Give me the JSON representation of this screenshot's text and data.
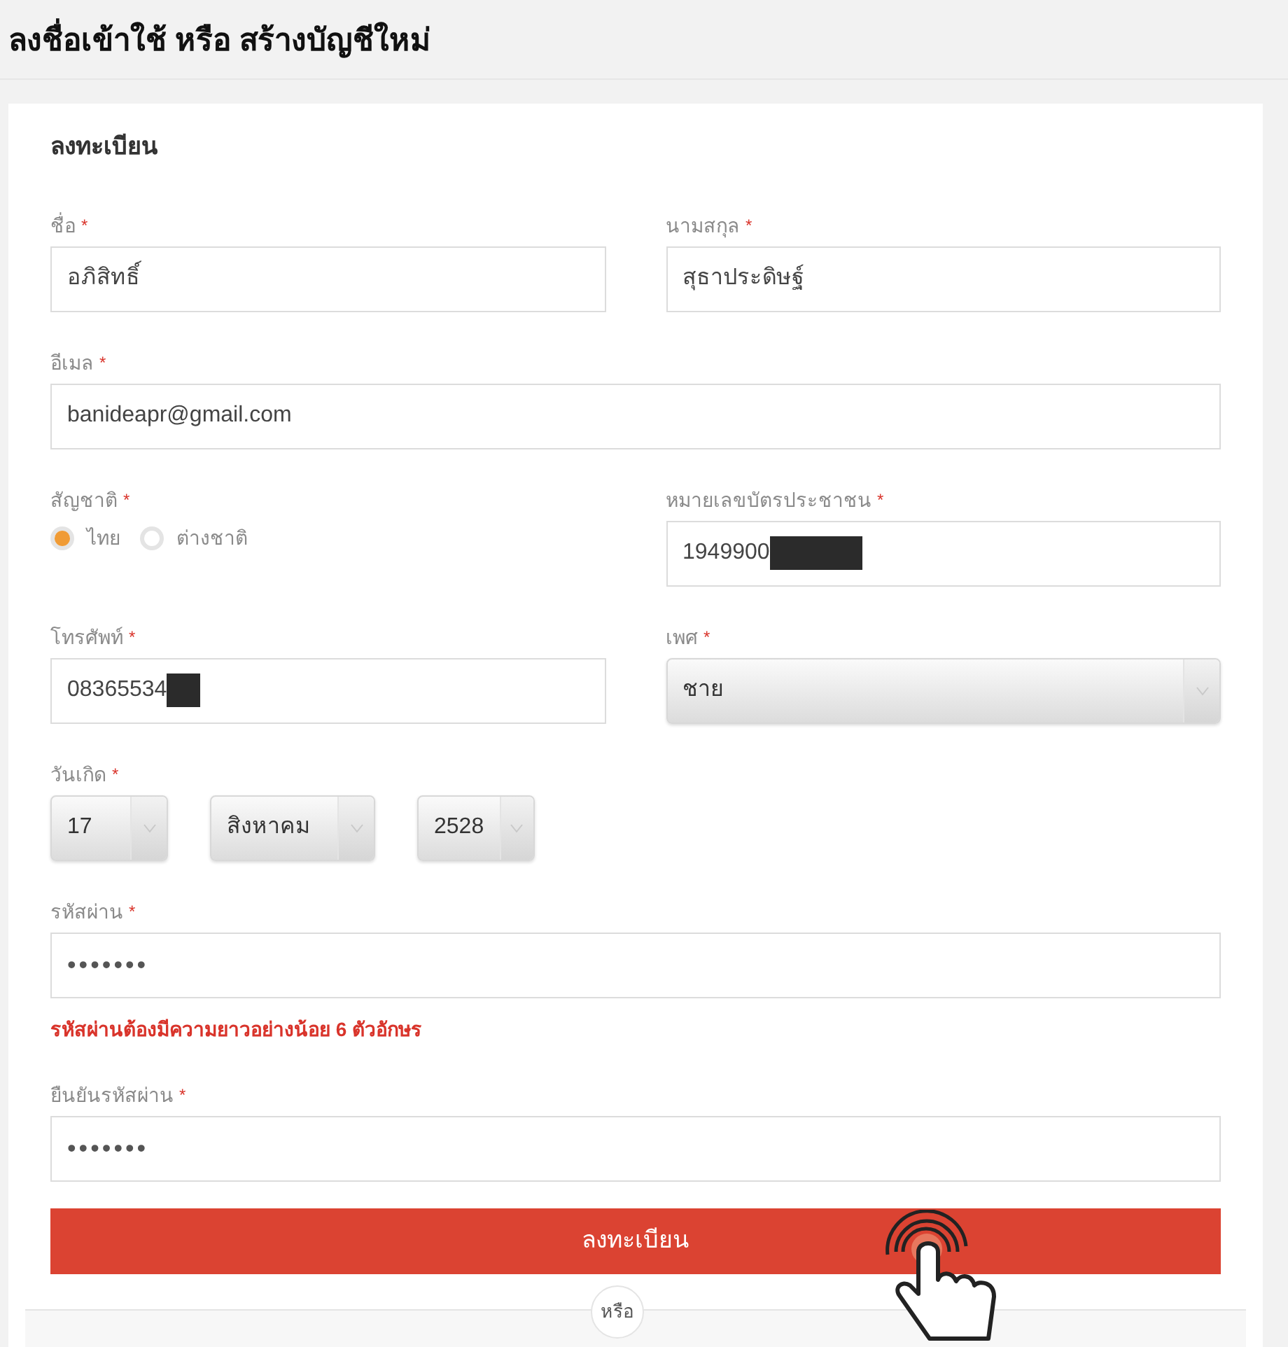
{
  "page_title": "ลงชื่อเข้าใช้ หรือ สร้างบัญชีใหม่",
  "form": {
    "title": "ลงทะเบียน",
    "rows": [
      [
        {
          "kind": "text",
          "label": "ชื่อ",
          "required_mark": "*",
          "value": "อภิสิทธิ์"
        },
        {
          "kind": "text",
          "label": "นามสกุล",
          "required_mark": "*",
          "value": "สุธาประดิษฐ์"
        }
      ],
      [
        {
          "kind": "text",
          "label": "อีเมล",
          "required_mark": "*",
          "value": "banideapr@gmail.com"
        }
      ],
      [
        {
          "kind": "radio",
          "label": "สัญชาติ",
          "required_mark": "*",
          "options": [
            {
              "label": "ไทย",
              "selected": true
            },
            {
              "label": "ต่างชาติ",
              "selected": false
            }
          ]
        },
        {
          "kind": "redacted",
          "label": "หมายเลขบัตรประชาชน",
          "required_mark": "*",
          "value": "1949900"
        }
      ],
      [
        {
          "kind": "redacted",
          "label": "โทรศัพท์",
          "required_mark": "*",
          "value": "08365534"
        },
        {
          "kind": "select",
          "label": "เพศ",
          "required_mark": "*",
          "value": "ชาย"
        }
      ],
      [
        {
          "kind": "date",
          "label": "วันเกิด",
          "required_mark": "*",
          "parts": [
            "17",
            "สิงหาคม",
            "2528"
          ]
        }
      ],
      [
        {
          "kind": "password",
          "label": "รหัสผ่าน",
          "required_mark": "*",
          "value": "•••••••",
          "error": "รหัสผ่านต้องมีความยาวอย่างน้อย 6 ตัวอักษร"
        }
      ],
      [
        {
          "kind": "password",
          "label": "ยืนยันรหัสผ่าน",
          "required_mark": "*",
          "value": "•••••••"
        }
      ]
    ],
    "submit": "ลงทะเบียน",
    "divider": "หรือ"
  }
}
